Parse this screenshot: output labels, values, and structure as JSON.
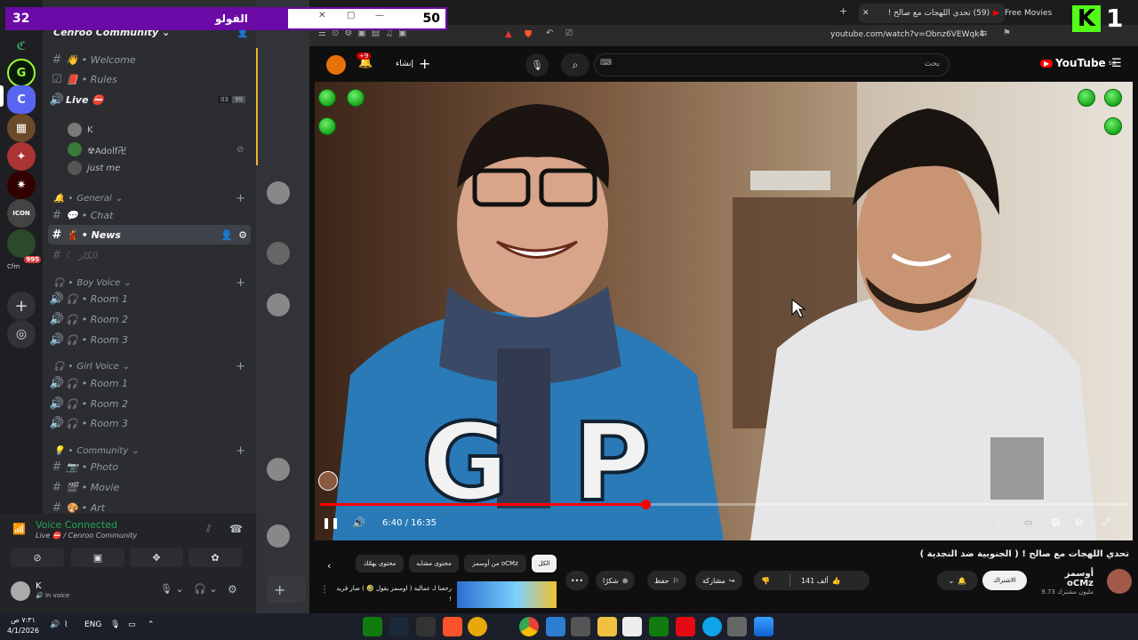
{
  "overlay": {
    "follow_current": "32",
    "follow_label": "الفولو",
    "follow_goal": "50",
    "follow_progress": 0.64,
    "kick_count": "1",
    "kick_letter": "K"
  },
  "discord": {
    "server_name": "Cenroo Community",
    "channels_top": [
      {
        "label": "• Welcome",
        "icon": "hash-icon"
      },
      {
        "label": "• Rules",
        "icon": "rules-icon"
      }
    ],
    "live": {
      "label": "Live",
      "count_a": "03",
      "count_b": "99"
    },
    "voice_users": [
      "K",
      "☢Adolf卍",
      "just me"
    ],
    "general": {
      "label": "General",
      "channels": [
        {
          "label": "• Chat"
        },
        {
          "label": "• News"
        },
        {
          "label": "الكار"
        }
      ]
    },
    "boy_voice": {
      "label": "Boy Voice",
      "rooms": [
        "• Room 1",
        "• Room 2",
        "• Room 3"
      ]
    },
    "girl_voice": {
      "label": "Girl Voice",
      "rooms": [
        "• Room 1",
        "• Room 2",
        "• Room 3"
      ]
    },
    "community": {
      "label": "Community",
      "channels": [
        {
          "label": "• Photo"
        },
        {
          "label": "• Movie"
        },
        {
          "label": "• Art"
        }
      ]
    },
    "server_badges": {
      "count": "995",
      "label": "Cfm"
    },
    "voice_panel": {
      "title": "Voice Connected",
      "subtitle": "Live ⛔ / Cenroo Community",
      "user": "K",
      "status": "In voice"
    }
  },
  "browser": {
    "tabs": [
      {
        "label": "Free Movies"
      },
      {
        "label": "(59) تحدي اللهجات مع صالح ! ("
      }
    ],
    "url": "youtube.com/watch?v=Obnz6VEWqk4"
  },
  "youtube": {
    "logo": "YouTube",
    "logo_region": "SA",
    "search_placeholder": "بحث",
    "create_label": "إنشاء",
    "notif_badge": "+9",
    "player": {
      "time": "6:40 / 16:35",
      "progress": 0.403
    },
    "title": "تحدي اللهجات مع صالح ! ( الجنوبية ضد النجدية )",
    "channel": {
      "name": "أوسمز oCMz",
      "subs": "9.73 مليون مشترك"
    },
    "subscribe": "الاشتراك",
    "actions": {
      "like_count": "141 ألف",
      "share": "مشاركة",
      "save": "حفظ",
      "thanks": "شكرًا",
      "more": "•••"
    },
    "chips": [
      {
        "label": "الكل",
        "selected": true
      },
      {
        "label": "من أوسمز oCMz",
        "selected": false
      },
      {
        "label": "محتوى مشابه",
        "selected": false
      },
      {
        "label": "محتوى يهمّك",
        "selected": false
      }
    ],
    "related": {
      "title": "رجعنا لـ عمالية ( اوسمز يقول 🤣 ) صار قريد !"
    }
  },
  "taskbar": {
    "time": "٧:٣١ ص",
    "date": "4/1/2026",
    "lang": "ENG"
  }
}
